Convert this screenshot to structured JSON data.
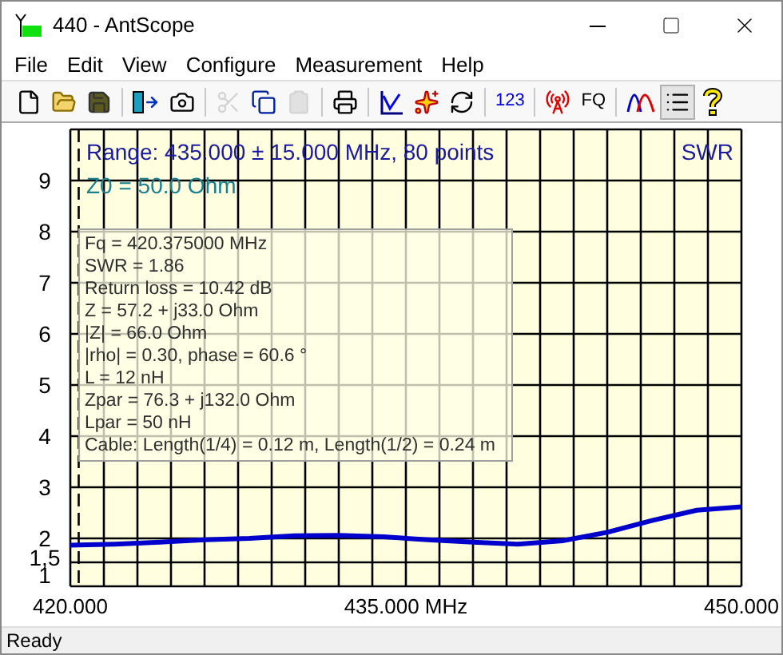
{
  "window": {
    "title": "440 - AntScope"
  },
  "menu": [
    "File",
    "Edit",
    "View",
    "Configure",
    "Measurement",
    "Help"
  ],
  "toolbar": [
    [
      {
        "kind": "new",
        "disabled": false,
        "pressed": false
      },
      {
        "kind": "open",
        "disabled": false,
        "pressed": false
      },
      {
        "kind": "save",
        "disabled": false,
        "pressed": false
      }
    ],
    [
      {
        "kind": "transfer",
        "disabled": false,
        "pressed": false
      },
      {
        "kind": "camera",
        "disabled": false,
        "pressed": false
      }
    ],
    [
      {
        "kind": "cut",
        "disabled": true,
        "pressed": false
      },
      {
        "kind": "copy",
        "disabled": false,
        "pressed": false
      },
      {
        "kind": "paste",
        "disabled": true,
        "pressed": false
      }
    ],
    [
      {
        "kind": "print",
        "disabled": false,
        "pressed": false
      }
    ],
    [
      {
        "kind": "chart",
        "disabled": false,
        "pressed": false
      },
      {
        "kind": "burst",
        "disabled": false,
        "pressed": false
      },
      {
        "kind": "refresh",
        "disabled": false,
        "pressed": false
      }
    ],
    [
      {
        "kind": "text",
        "label": "123",
        "disabled": false,
        "pressed": false
      }
    ],
    [
      {
        "kind": "antenna",
        "disabled": false,
        "pressed": false
      },
      {
        "kind": "text",
        "label": "FQ",
        "disabled": false,
        "pressed": false
      }
    ],
    [
      {
        "kind": "curves",
        "disabled": false,
        "pressed": false
      },
      {
        "kind": "list",
        "disabled": false,
        "pressed": true
      },
      {
        "kind": "help",
        "disabled": false,
        "pressed": false
      }
    ]
  ],
  "plot": {
    "range_text": "Range: 435.000 ± 15.000 MHz, 80 points",
    "z0_text": "Z0 = 50.0 Ohm",
    "chart_data": {
      "type": "line",
      "x": [
        420,
        422,
        424,
        426,
        428,
        430,
        432,
        434,
        436,
        438,
        440,
        442,
        444,
        446,
        448,
        450
      ],
      "series": [
        {
          "name": "SWR",
          "color": "#0000cc",
          "values": [
            1.86,
            1.88,
            1.92,
            1.97,
            2.0,
            2.05,
            2.06,
            2.03,
            1.97,
            1.92,
            1.88,
            1.95,
            2.12,
            2.35,
            2.55,
            2.62
          ]
        }
      ],
      "xlim": [
        420,
        450
      ],
      "ylim": [
        1,
        10
      ],
      "grid": true,
      "ref_lines": [
        {
          "axis": "x",
          "value": 420.375
        }
      ],
      "xticks": [
        {
          "value": 420,
          "label": "420.000"
        },
        {
          "value": 435,
          "label": "435.000 MHz"
        },
        {
          "value": 450,
          "label": "450.000"
        }
      ],
      "yticks": [
        {
          "value": 1,
          "label": "1"
        },
        {
          "value": 1.5,
          "label": "1,5"
        },
        2,
        3,
        4,
        5,
        6,
        7,
        8,
        9
      ]
    },
    "marker": {
      "lines": [
        "Fq = 420.375000 MHz",
        "SWR = 1.86",
        "Return loss = 10.42 dB",
        "Z = 57.2 + j33.0 Ohm",
        "|Z| = 66.0 Ohm",
        "|rho| = 0.30, phase = 60.6 °",
        "L = 12 nH",
        "Zpar = 76.3 + j132.0 Ohm",
        "Lpar = 50 nH",
        "Cable: Length(1/4) = 0.12 m, Length(1/2) = 0.24 m"
      ]
    }
  },
  "status_bar": "Ready"
}
